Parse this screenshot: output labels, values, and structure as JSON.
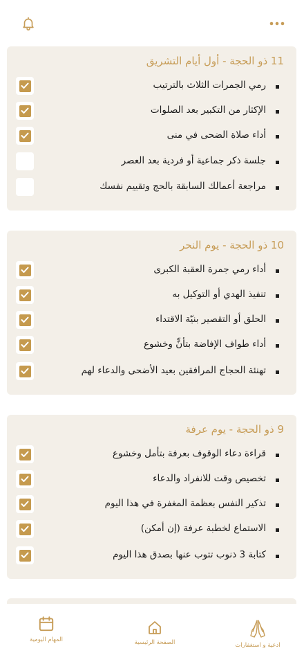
{
  "colors": {
    "accent": "#c79d58",
    "card_bg": "#f3efe8",
    "check": "#c59a4e"
  },
  "header": {
    "left_icon": "bell-icon",
    "right_icon": "more-dots-icon"
  },
  "sections": [
    {
      "title": "11 ذو الحجة - أول أيام التشريق",
      "tasks": [
        {
          "label": "رمي الجمرات الثلاث بالترتيب",
          "checked": true
        },
        {
          "label": "الإكثار من التكبير بعد الصلوات",
          "checked": true
        },
        {
          "label": "أداء صلاة الضحى في منى",
          "checked": true
        },
        {
          "label": "جلسة ذكر جماعية أو فردية بعد العصر",
          "checked": false
        },
        {
          "label": "مراجعة أعمالك السابقة بالحج وتقييم نفسك",
          "checked": false
        }
      ]
    },
    {
      "title": "10 ذو الحجة - يوم النحر",
      "tasks": [
        {
          "label": "أداء رمي جمرة العقبة الكبرى",
          "checked": true
        },
        {
          "label": "تنفيذ الهدي أو التوكيل به",
          "checked": true
        },
        {
          "label": "الحلق أو التقصير بنيّة الاقتداء",
          "checked": true
        },
        {
          "label": "أداء طواف الإفاضة بتأنٍّ وخشوع",
          "checked": true
        },
        {
          "label": "تهنئة الحجاج المرافقين بعيد الأضحى والدعاء لهم",
          "checked": true
        }
      ]
    },
    {
      "title": "9 ذو الحجة - يوم عرفة",
      "tasks": [
        {
          "label": "قراءة دعاء الوقوف بعرفة بتأمل وخشوع",
          "checked": true
        },
        {
          "label": "تخصيص وقت للانفراد والدعاء",
          "checked": true
        },
        {
          "label": "تذكير النفس بعظمة المغفرة في هذا اليوم",
          "checked": true
        },
        {
          "label": "الاستماع لخطبة عرفة (إن أمكن)",
          "checked": true
        },
        {
          "label": "كتابة 3 ذنوب تتوب عنها بصدق هذا اليوم",
          "checked": true
        }
      ]
    }
  ],
  "bottom_nav": [
    {
      "label": "المهام اليومية",
      "icon": "calendar-icon"
    },
    {
      "label": "الصفحة الرئيسية",
      "icon": "home-icon"
    },
    {
      "label": "ادعية و استغفارات",
      "icon": "praying-hands-icon"
    }
  ]
}
